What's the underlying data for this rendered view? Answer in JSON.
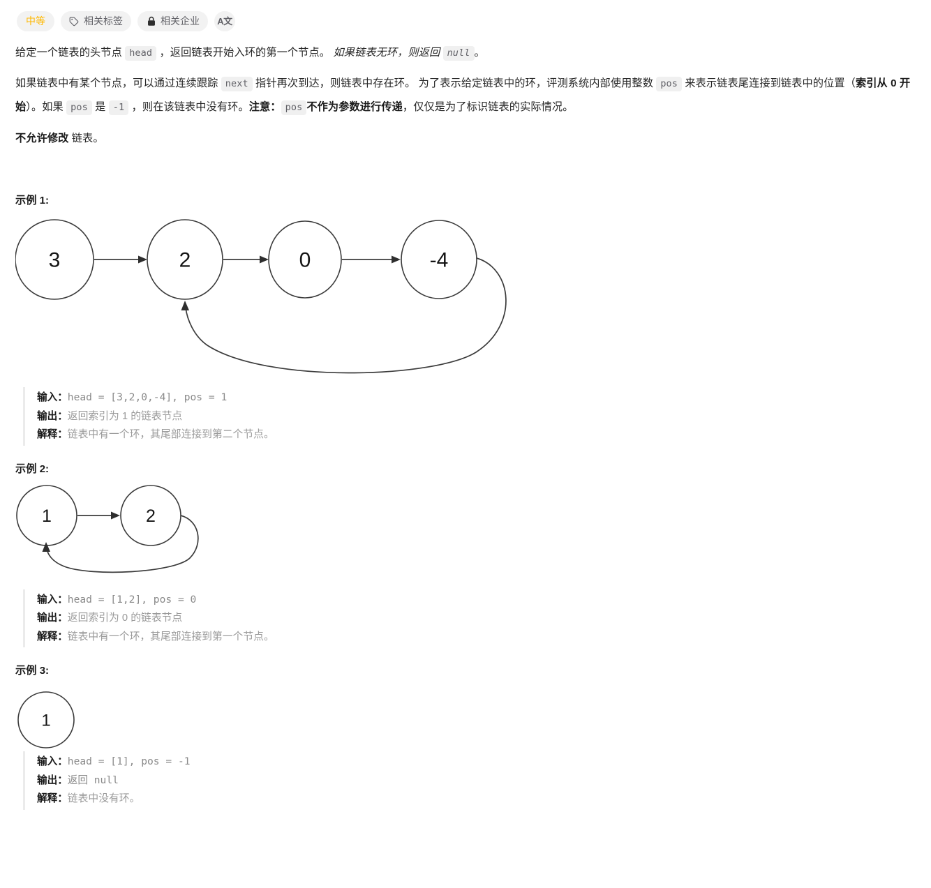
{
  "badges": [
    {
      "id": "difficulty",
      "label": "中等",
      "icon": null,
      "style": "difficulty"
    },
    {
      "id": "related-tags",
      "label": "相关标签",
      "icon": "tag-icon",
      "style": "plain"
    },
    {
      "id": "related-companies",
      "label": "相关企业",
      "icon": "lock-icon",
      "style": "plain"
    },
    {
      "id": "translate",
      "label": "A文",
      "icon": "translate-icon",
      "style": "round"
    }
  ],
  "paragraphs": {
    "p1": {
      "seg1": "给定一个链表的头节点 ",
      "code1": "head",
      "seg2": " ，返回链表开始入环的第一个节点。 ",
      "italic1": "如果链表无环，则返回 ",
      "italic_code": "null",
      "seg3": "。"
    },
    "p2": {
      "seg1": "如果链表中有某个节点，可以通过连续跟踪 ",
      "code1": "next",
      "seg2": " 指针再次到达，则链表中存在环。 为了表示给定链表中的环，评测系统内部使用整数 ",
      "code2": "pos",
      "seg3": " 来表示链表尾连接到链表中的位置（",
      "bold1": "索引从 0 开始",
      "seg4": "）。如果 ",
      "code3": "pos",
      "seg5": " 是 ",
      "code4": "-1",
      "seg6": " ，则在该链表中没有环。",
      "bold2": "注意：",
      "code5": "pos",
      "bold3": "不作为参数进行传递",
      "seg7": "，仅仅是为了标识链表的实际情况。"
    },
    "p3": {
      "bold1": "不允许修改",
      "seg1": " 链表。"
    }
  },
  "examples": [
    {
      "title": "示例 1:",
      "input_key": "输入：",
      "input_value": "head = [3,2,0,-4], pos = 1",
      "output_key": "输出：",
      "output_value": "返回索引为 1 的链表节点",
      "explain_key": "解释：",
      "explain_value": "链表中有一个环，其尾部连接到第二个节点。",
      "diagram": {
        "nodes": [
          "3",
          "2",
          "0",
          "-4"
        ],
        "cycle_to_index": 1
      }
    },
    {
      "title": "示例 2:",
      "input_key": "输入：",
      "input_value": "head = [1,2], pos = 0",
      "output_key": "输出：",
      "output_value": "返回索引为 0 的链表节点",
      "explain_key": "解释：",
      "explain_value": "链表中有一个环，其尾部连接到第一个节点。",
      "diagram": {
        "nodes": [
          "1",
          "2"
        ],
        "cycle_to_index": 0
      }
    },
    {
      "title": "示例 3:",
      "input_key": "输入：",
      "input_value": "head = [1], pos = -1",
      "output_key": "输出：",
      "output_value": "返回 null",
      "explain_key": "解释：",
      "explain_value": "链表中没有环。",
      "diagram": {
        "nodes": [
          "1"
        ],
        "cycle_to_index": -1
      }
    }
  ],
  "colors": {
    "difficulty": "#ffb800",
    "badge_bg": "#f2f2f2",
    "code_bg": "#f0f0f0",
    "muted_text": "#999999",
    "body_text": "#262626",
    "diagram_stroke": "#3b3b3b",
    "block_border": "#ebebeb"
  }
}
